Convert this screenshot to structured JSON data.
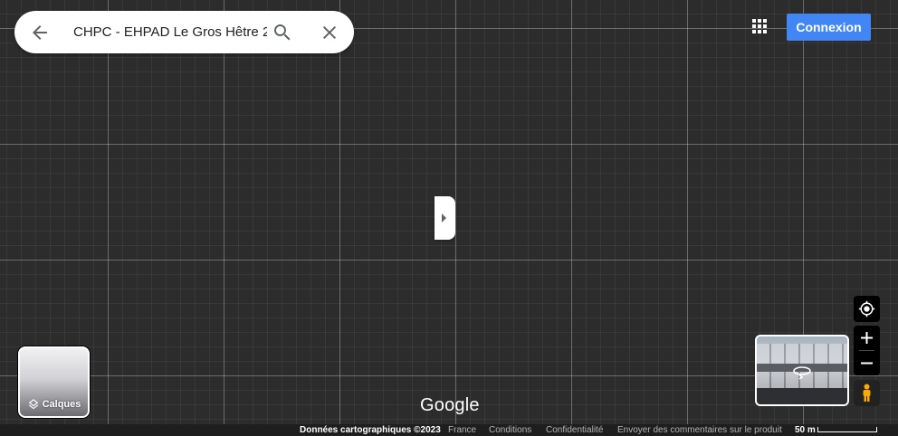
{
  "search": {
    "query": "CHPC - EHPAD Le Gros Hêtre 2",
    "back_icon": "arrow-back-icon",
    "search_icon": "search-icon",
    "clear_icon": "close-icon"
  },
  "header": {
    "apps_icon": "apps-grid-icon",
    "signin_label": "Connexion",
    "accent_color": "#4285f4"
  },
  "side_panel": {
    "collapse_icon": "triangle-right-icon"
  },
  "layers": {
    "label": "Calques",
    "icon": "layers-icon"
  },
  "controls": {
    "locate_icon": "my-location-icon",
    "zoom_in_icon": "plus-icon",
    "zoom_out_icon": "minus-icon",
    "pegman_icon": "pegman-icon",
    "streetview_icon": "rotate-360-icon"
  },
  "logo": {
    "text": "Google"
  },
  "footer": {
    "data_credit": "Données cartographiques ©2023",
    "country": "France",
    "terms": "Conditions",
    "privacy": "Confidentialité",
    "feedback": "Envoyer des commentaires sur le produit",
    "scale": "50 m"
  }
}
